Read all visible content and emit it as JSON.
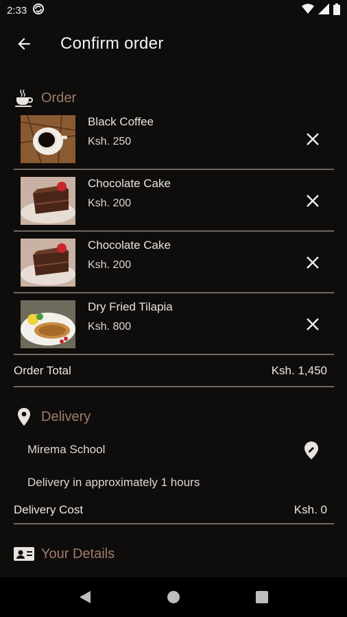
{
  "status": {
    "time": "2:33"
  },
  "appbar": {
    "title": "Confirm order"
  },
  "order": {
    "heading": "Order",
    "items": [
      {
        "name": "Black Coffee",
        "price": "Ksh. 250"
      },
      {
        "name": "Chocolate Cake",
        "price": "Ksh. 200"
      },
      {
        "name": "Chocolate Cake",
        "price": "Ksh. 200"
      },
      {
        "name": "Dry Fried Tilapia",
        "price": "Ksh. 800"
      }
    ],
    "total_label": "Order Total",
    "total_value": "Ksh. 1,450"
  },
  "delivery": {
    "heading": "Delivery",
    "location": "Mirema School",
    "eta": "Delivery in approximately 1 hours",
    "cost_label": "Delivery Cost",
    "cost_value": "Ksh. 0"
  },
  "details": {
    "heading": "Your Details"
  },
  "icons": {
    "back": "arrow-back-icon",
    "order": "coffee-cup-icon",
    "remove": "close-icon",
    "delivery": "location-pin-icon",
    "edit_location": "edit-location-icon",
    "details": "contact-card-icon"
  },
  "colors": {
    "background": "#0f0d0c",
    "section_heading": "#9f7c6c",
    "divider": "#6d6864"
  }
}
